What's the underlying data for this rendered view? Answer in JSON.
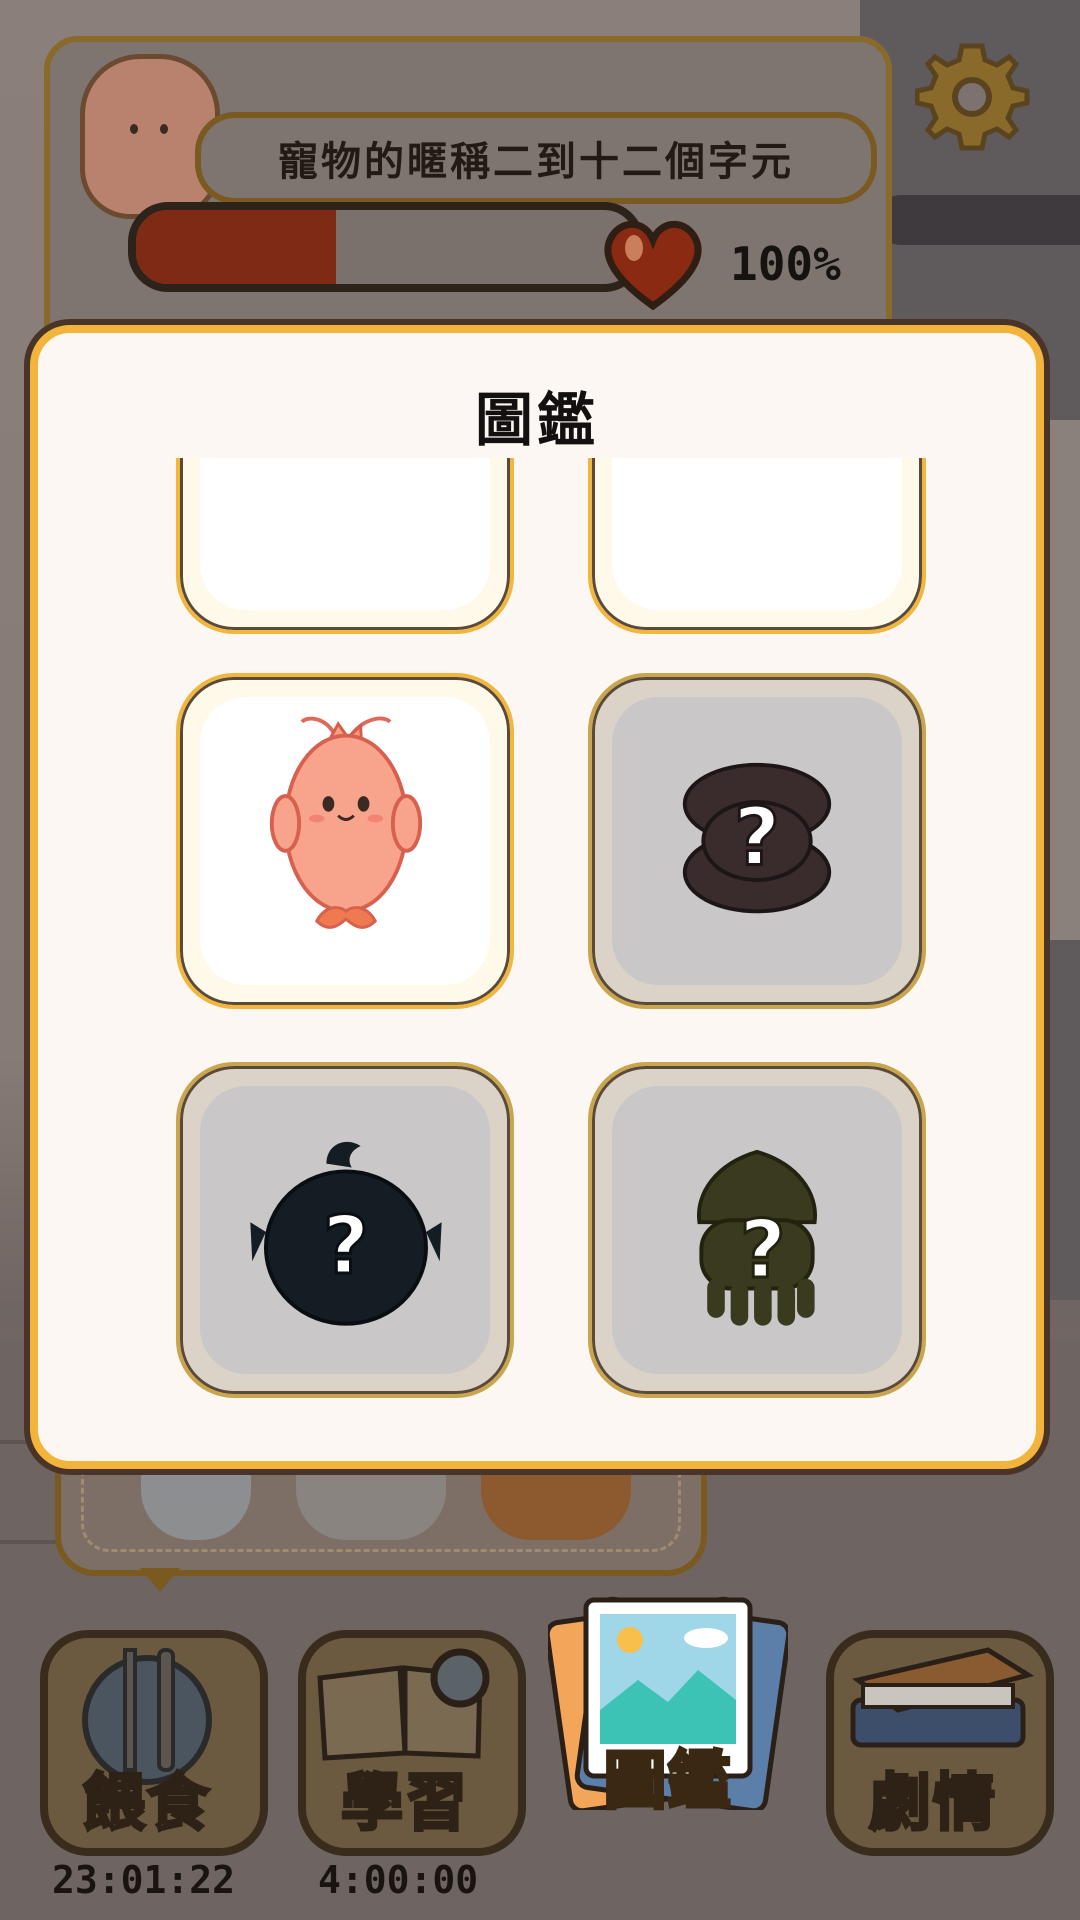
{
  "status": {
    "pet_name": "寵物的暱稱二到十二個字元",
    "health_percent": "100%",
    "health_fill": 0.4
  },
  "modal": {
    "title": "圖鑑",
    "cards": [
      {
        "state": "unlocked-partial",
        "label": ""
      },
      {
        "state": "unlocked-partial",
        "label": ""
      },
      {
        "state": "unlocked",
        "creature": "shrimp"
      },
      {
        "state": "locked",
        "creature": "clam",
        "mark": "?"
      },
      {
        "state": "locked",
        "creature": "pufferfish",
        "mark": "?"
      },
      {
        "state": "locked",
        "creature": "squid",
        "mark": "?"
      }
    ]
  },
  "nav": {
    "feed_label": "餵食",
    "study_label": "學習",
    "collection_label": "圖鑑",
    "story_label": "劇情",
    "feed_timer": "23:01:22",
    "study_timer": "4:00:00"
  }
}
